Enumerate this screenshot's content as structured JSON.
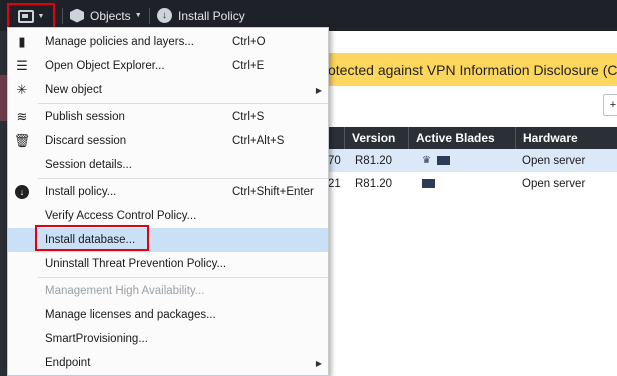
{
  "toolbar": {
    "objects_label": "Objects",
    "install_policy_label": "Install Policy"
  },
  "banner": {
    "text": "otected against VPN Information Disclosure (CV"
  },
  "table": {
    "headers": [
      "Version",
      "Active Blades",
      "Hardware"
    ],
    "rows": [
      {
        "id_suffix": "70",
        "version": "R81.20",
        "hardware": "Open server",
        "selected": true
      },
      {
        "id_suffix": "21",
        "version": "R81.20",
        "hardware": "Open server",
        "selected": false
      }
    ]
  },
  "menu": {
    "items": [
      {
        "label": "Manage policies and layers...",
        "shortcut": "Ctrl+O",
        "icon": "policy-layers-icon"
      },
      {
        "label": "Open Object Explorer...",
        "shortcut": "Ctrl+E",
        "icon": "list-icon"
      },
      {
        "label": "New object",
        "shortcut": "",
        "icon": "new-star-icon",
        "submenu": true
      },
      {
        "label": "Publish session",
        "shortcut": "Ctrl+S",
        "icon": "publish-icon"
      },
      {
        "label": "Discard session",
        "shortcut": "Ctrl+Alt+S",
        "icon": "trash-icon"
      },
      {
        "label": "Session details...",
        "shortcut": "",
        "icon": ""
      },
      {
        "label": "Install policy...",
        "shortcut": "Ctrl+Shift+Enter",
        "icon": "install-down-icon"
      },
      {
        "label": "Verify Access Control Policy...",
        "shortcut": "",
        "icon": ""
      },
      {
        "label": "Install database...",
        "shortcut": "",
        "icon": "",
        "highlighted": true
      },
      {
        "label": "Uninstall Threat Prevention Policy...",
        "shortcut": "",
        "icon": ""
      },
      {
        "label": "Management High Availability...",
        "shortcut": "",
        "icon": "",
        "disabled": true
      },
      {
        "label": "Manage licenses and packages...",
        "shortcut": "",
        "icon": ""
      },
      {
        "label": "SmartProvisioning...",
        "shortcut": "",
        "icon": ""
      },
      {
        "label": "Endpoint",
        "shortcut": "",
        "icon": "",
        "submenu": true
      }
    ]
  },
  "colors": {
    "toolbar_bg": "#1e2228",
    "highlight": "#c9e0f7",
    "annotation_red": "#e3000f",
    "banner": "#fdd65e"
  }
}
